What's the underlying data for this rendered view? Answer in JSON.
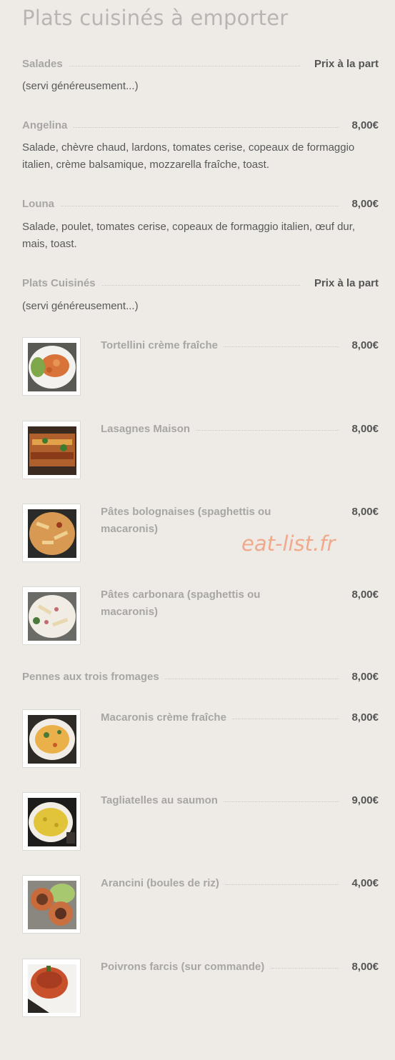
{
  "page_title": "Plats cuisinés à emporter",
  "watermark": "eat-list.fr",
  "sections": [
    {
      "name": "Salades",
      "price_header": "Prix à la part",
      "note": "(servi généreusement...)"
    },
    {
      "name": "Plats Cuisinés",
      "price_header": "Prix à la part",
      "note": "(servi généreusement...)"
    }
  ],
  "salads": [
    {
      "name": "Angelina",
      "price": "8,00€",
      "description": "Salade, chèvre chaud, lardons, tomates cerise, copeaux de formaggio italien, crème balsamique, mozzarella fraîche, toast."
    },
    {
      "name": "Louna",
      "price": "8,00€",
      "description": "Salade, poulet, tomates cerise, copeaux de formaggio italien, œuf dur, mais, toast."
    }
  ],
  "dishes": [
    {
      "name": "Tortellini crème fraîche",
      "price": "8,00€",
      "image": "tortellini-photo"
    },
    {
      "name": "Lasagnes Maison",
      "price": "8,00€",
      "image": "lasagna-photo"
    },
    {
      "name": "Pâtes bolognaises (spaghettis ou macaronis)",
      "price": "8,00€",
      "image": "bolognese-photo"
    },
    {
      "name": "Pâtes carbonara (spaghettis ou macaronis)",
      "price": "8,00€",
      "image": "carbonara-photo"
    },
    {
      "name": "Pennes aux trois fromages",
      "price": "8,00€"
    },
    {
      "name": "Macaronis crème fraîche",
      "price": "8,00€",
      "image": "macaroni-photo"
    },
    {
      "name": "Tagliatelles au saumon",
      "price": "9,00€",
      "image": "tagliatelle-photo"
    },
    {
      "name": "Arancini (boules de riz)",
      "price": "4,00€",
      "image": "arancini-photo"
    },
    {
      "name": "Poivrons farcis (sur commande)",
      "price": "8,00€",
      "image": "stuffed-pepper-photo"
    }
  ]
}
